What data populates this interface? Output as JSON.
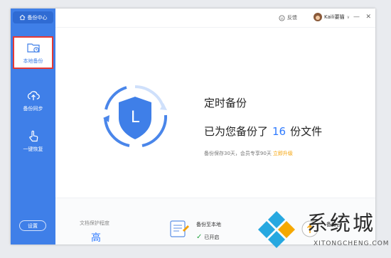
{
  "sidebar": {
    "brand": "备份中心",
    "items": [
      {
        "label": "本地备份",
        "icon": "folder-clock-icon",
        "active": true
      },
      {
        "label": "备份同步",
        "icon": "cloud-upload-icon",
        "active": false
      },
      {
        "label": "一键恢复",
        "icon": "touch-hand-icon",
        "active": false
      }
    ],
    "settings": "设置"
  },
  "topbar": {
    "feedback": "反馈",
    "username": "Kaili要猫",
    "minimize": "—",
    "close": "✕"
  },
  "hero": {
    "title": "定时备份",
    "count_prefix": "已为您备份了",
    "count": "16",
    "count_suffix": "份文件",
    "note": "备份保存30天，会员专享90天",
    "upgrade": "立即升级",
    "shield_letter": "L"
  },
  "bottom": {
    "level_label": "文档保护程度",
    "level_value": "高",
    "local_label": "备份至本地",
    "local_status": "已开启",
    "cloud_label": "备份云"
  },
  "watermark": {
    "title": "系统城",
    "url": "XITONGCHENG.COM"
  },
  "colors": {
    "accent": "#3f7fe8",
    "count": "#2f7bff",
    "upgrade": "#f5a000",
    "active_border": "#e53935"
  }
}
